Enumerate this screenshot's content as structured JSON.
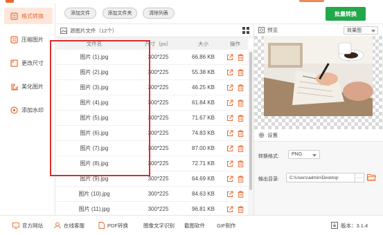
{
  "sidebar": {
    "items": [
      {
        "label": "格式转换",
        "icon": "format-convert-icon",
        "active": true
      },
      {
        "label": "压缩图片",
        "icon": "compress-icon",
        "active": false
      },
      {
        "label": "更改尺寸",
        "icon": "resize-icon",
        "active": false
      },
      {
        "label": "美化图片",
        "icon": "beautify-icon",
        "active": false
      },
      {
        "label": "添加水印",
        "icon": "watermark-icon",
        "active": false
      }
    ]
  },
  "toolbar": {
    "add_file": "添加文件",
    "add_folder": "添加文件夹",
    "clear_list": "清除列表",
    "batch_convert": "批量转换"
  },
  "list": {
    "title": "源图片文件（12个）",
    "columns": [
      "文件名",
      "尺寸（px）",
      "大小",
      "操作"
    ],
    "rows": [
      {
        "name": "图片 (1).jpg",
        "dims": "300*225",
        "size": "66.86 KB"
      },
      {
        "name": "图片 (2).jpg",
        "dims": "300*225",
        "size": "55.38 KB"
      },
      {
        "name": "图片 (3).jpg",
        "dims": "300*225",
        "size": "46.25 KB"
      },
      {
        "name": "图片 (4).jpg",
        "dims": "300*225",
        "size": "61.84 KB"
      },
      {
        "name": "图片 (5).jpg",
        "dims": "300*225",
        "size": "71.67 KB"
      },
      {
        "name": "图片 (6).jpg",
        "dims": "300*225",
        "size": "74.83 KB"
      },
      {
        "name": "图片 (7).jpg",
        "dims": "300*225",
        "size": "87.00 KB"
      },
      {
        "name": "图片 (8).jpg",
        "dims": "300*225",
        "size": "72.71 KB"
      },
      {
        "name": "图片 (9).jpg",
        "dims": "300*225",
        "size": "64.69 KB"
      },
      {
        "name": "图片 (10).jpg",
        "dims": "300*225",
        "size": "84.63 KB"
      },
      {
        "name": "图片 (11).jpg",
        "dims": "300*225",
        "size": "96.81 KB"
      }
    ]
  },
  "preview": {
    "title": "预览",
    "mode": "效果图"
  },
  "settings": {
    "title": "设置",
    "format_label": "转换格式:",
    "format_value": "PNG",
    "output_label": "输出目录:",
    "output_value": "C:\\Users\\admin\\Desktop",
    "more": "···"
  },
  "footer": {
    "website": "官方网站",
    "support": "在线客服",
    "pdf": "PDF转换",
    "ocr": "图像文字识别",
    "screenshot": "截图软件",
    "gif": "GIF制作",
    "version": "版本：3.1.4"
  },
  "colors": {
    "accent": "#e8692f",
    "green": "#22a84a",
    "highlight": "#d92b2b"
  }
}
